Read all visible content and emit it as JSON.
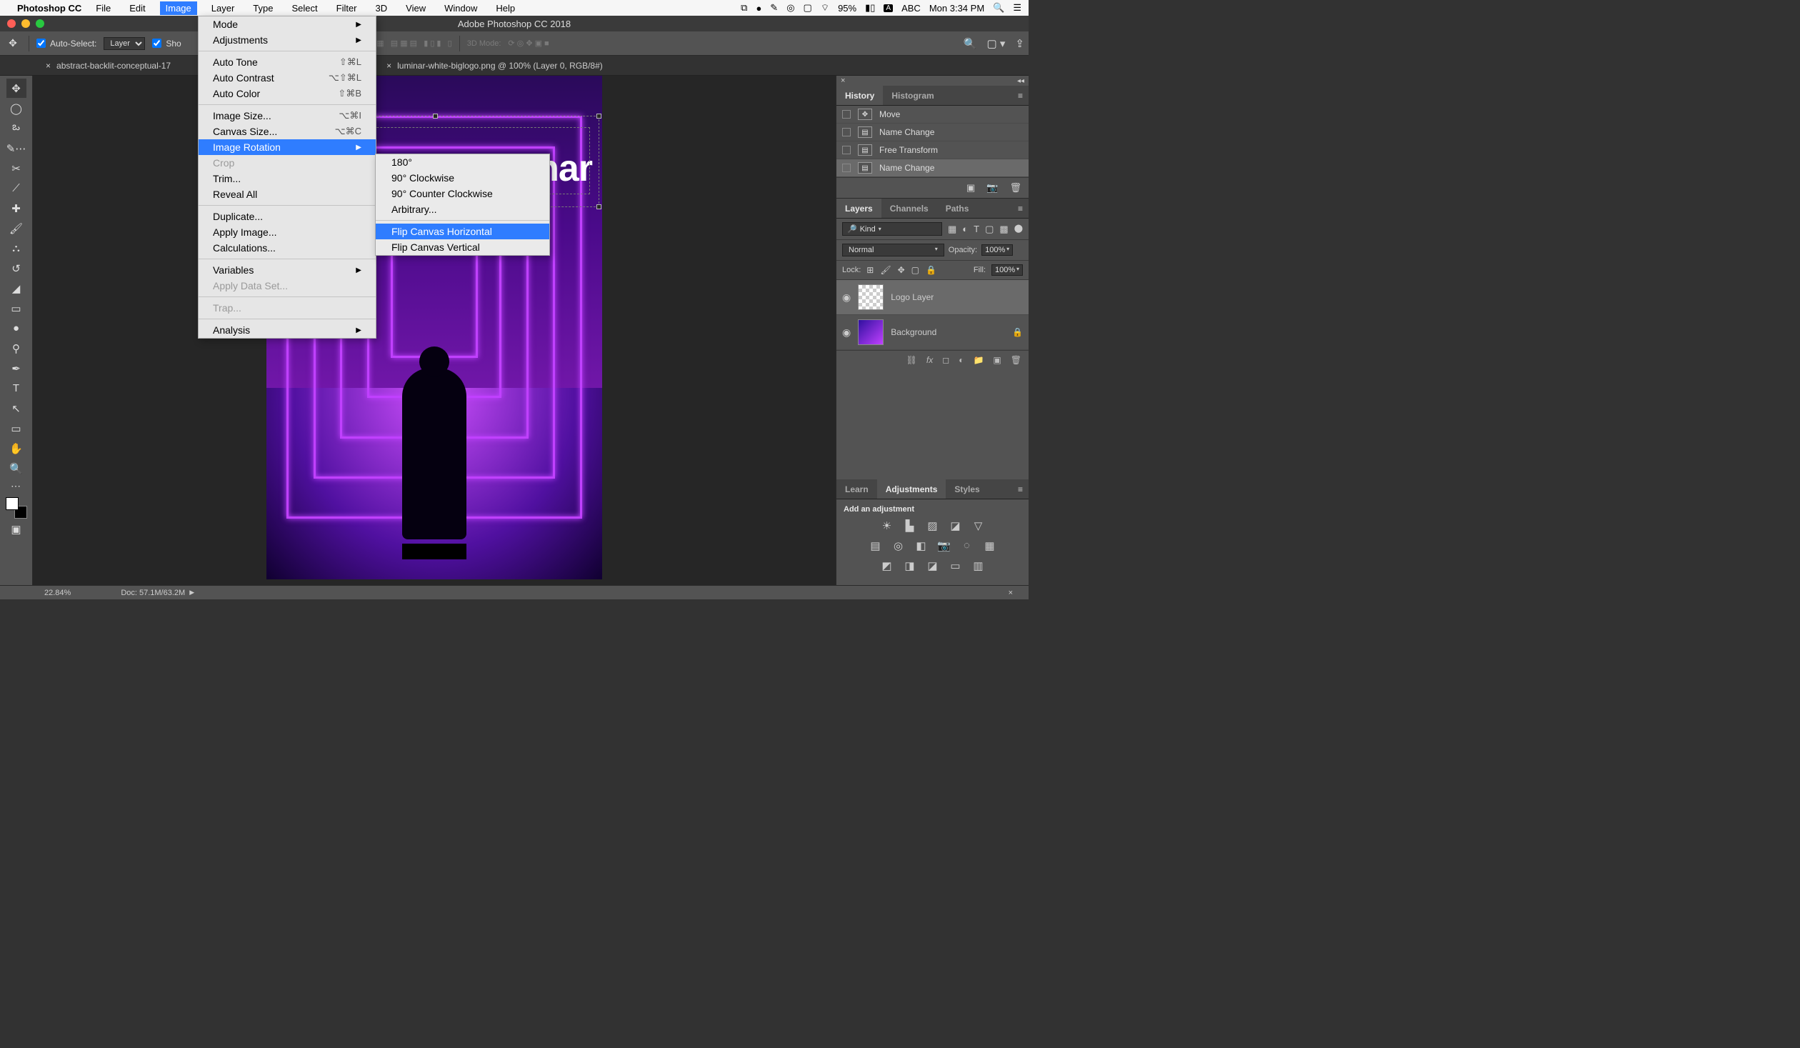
{
  "menubar": {
    "app_name": "Photoshop CC",
    "items": [
      "File",
      "Edit",
      "Image",
      "Layer",
      "Type",
      "Select",
      "Filter",
      "3D",
      "View",
      "Window",
      "Help"
    ],
    "highlighted_index": 2,
    "right": {
      "battery_pct": "95%",
      "input_badge": "A",
      "input_label": "ABC",
      "clock": "Mon 3:34 PM"
    }
  },
  "window": {
    "title": "Adobe Photoshop CC 2018"
  },
  "options": {
    "auto_select_label": "Auto-Select:",
    "auto_select_checked": true,
    "auto_select_target": "Layer",
    "show_transform_label": "Sho",
    "show_transform_checked": true,
    "mode_label": "3D Mode:"
  },
  "tabs": [
    {
      "label": "abstract-backlit-conceptual-17"
    },
    {
      "label": "luminar-white-biglogo.png @ 100% (Layer 0, RGB/8#)"
    }
  ],
  "image_menu": {
    "groups": [
      [
        {
          "label": "Mode",
          "arrow": true
        },
        {
          "label": "Adjustments",
          "arrow": true
        }
      ],
      [
        {
          "label": "Auto Tone",
          "shortcut": "⇧⌘L"
        },
        {
          "label": "Auto Contrast",
          "shortcut": "⌥⇧⌘L"
        },
        {
          "label": "Auto Color",
          "shortcut": "⇧⌘B"
        }
      ],
      [
        {
          "label": "Image Size...",
          "shortcut": "⌥⌘I"
        },
        {
          "label": "Canvas Size...",
          "shortcut": "⌥⌘C"
        },
        {
          "label": "Image Rotation",
          "arrow": true,
          "highlighted": true
        },
        {
          "label": "Crop",
          "disabled": true
        },
        {
          "label": "Trim..."
        },
        {
          "label": "Reveal All"
        }
      ],
      [
        {
          "label": "Duplicate..."
        },
        {
          "label": "Apply Image..."
        },
        {
          "label": "Calculations..."
        }
      ],
      [
        {
          "label": "Variables",
          "arrow": true
        },
        {
          "label": "Apply Data Set...",
          "disabled": true
        }
      ],
      [
        {
          "label": "Trap...",
          "disabled": true
        }
      ],
      [
        {
          "label": "Analysis",
          "arrow": true
        }
      ]
    ]
  },
  "rotation_submenu": {
    "groups": [
      [
        {
          "label": "180°"
        },
        {
          "label": "90° Clockwise"
        },
        {
          "label": "90° Counter Clockwise"
        },
        {
          "label": "Arbitrary..."
        }
      ],
      [
        {
          "label": "Flip Canvas Horizontal",
          "highlighted": true
        },
        {
          "label": "Flip Canvas Vertical"
        }
      ]
    ]
  },
  "canvas": {
    "logo_text": "minar"
  },
  "history_panel": {
    "tabs": [
      "History",
      "Histogram"
    ],
    "active_tab": 0,
    "rows": [
      {
        "label": "Move",
        "icon": "move"
      },
      {
        "label": "Name Change",
        "icon": "doc"
      },
      {
        "label": "Free Transform",
        "icon": "doc"
      },
      {
        "label": "Name Change",
        "icon": "doc",
        "active": true
      }
    ]
  },
  "layers_panel": {
    "tabs": [
      "Layers",
      "Channels",
      "Paths"
    ],
    "active_tab": 0,
    "kind_label": "Kind",
    "blend_mode": "Normal",
    "opacity_label": "Opacity:",
    "opacity_value": "100%",
    "lock_label": "Lock:",
    "fill_label": "Fill:",
    "fill_value": "100%",
    "layers": [
      {
        "name": "Logo Layer",
        "active": true,
        "thumb": "checker"
      },
      {
        "name": "Background",
        "locked": true,
        "thumb": "img"
      }
    ]
  },
  "adjust_panel": {
    "tabs": [
      "Learn",
      "Adjustments",
      "Styles"
    ],
    "active_tab": 1,
    "title": "Add an adjustment"
  },
  "status": {
    "zoom": "22.84%",
    "doc": "Doc: 57.1M/63.2M"
  }
}
